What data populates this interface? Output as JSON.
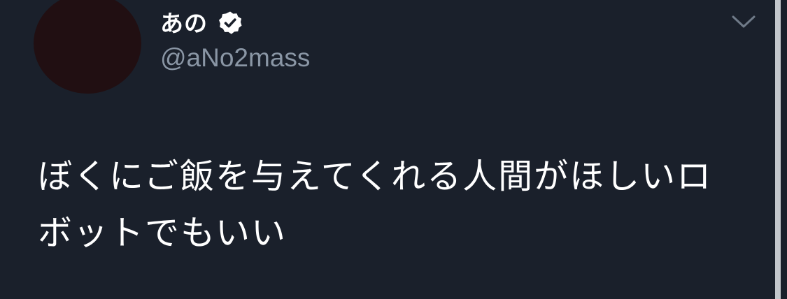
{
  "tweet": {
    "author": {
      "display_name": "あの",
      "verified": true,
      "handle": "@aNo2mass"
    },
    "text": "ぼくにご飯を与えてくれる人間がほしいロボットでもいい"
  },
  "icons": {
    "verified": "verified-badge-icon",
    "menu": "chevron-down-icon"
  },
  "colors": {
    "background": "#1a202b",
    "text": "#ffffff",
    "handle": "#8a96a5",
    "avatar": "#210f12",
    "scrollbar": "#c3c7cc"
  }
}
